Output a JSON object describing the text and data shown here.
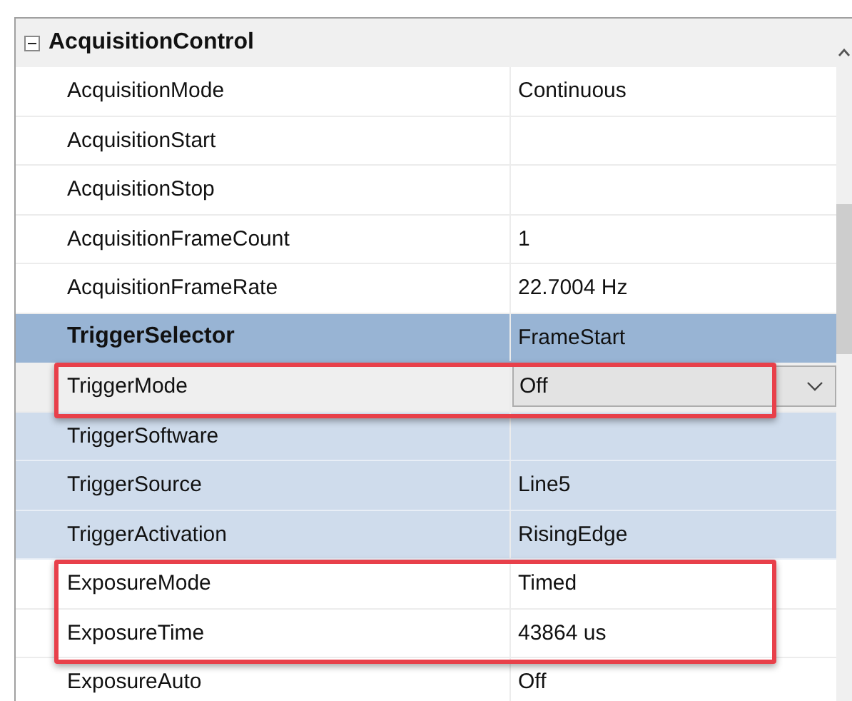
{
  "category": {
    "title": "AcquisitionControl",
    "expanded": true,
    "rows": [
      {
        "name": "AcquisitionMode",
        "value": "Continuous",
        "selected": false,
        "related": false,
        "editing": false,
        "annotated": false
      },
      {
        "name": "AcquisitionStart",
        "selected": false,
        "related": false,
        "editing": false,
        "annotated": false
      },
      {
        "name": "AcquisitionStop",
        "selected": false,
        "related": false,
        "editing": false,
        "annotated": false
      },
      {
        "name": "AcquisitionFrameCount",
        "value": "1",
        "selected": false,
        "related": false,
        "editing": false,
        "annotated": false
      },
      {
        "name": "AcquisitionFrameRate",
        "value": "22.7004 Hz",
        "selected": false,
        "related": false,
        "editing": false,
        "annotated": false
      },
      {
        "name": "TriggerSelector",
        "value": "FrameStart",
        "selected": true,
        "related": false,
        "editing": false,
        "annotated": false
      },
      {
        "name": "TriggerMode",
        "value": "Off",
        "selected": false,
        "related": false,
        "editing": true,
        "annotated": true
      },
      {
        "name": "TriggerSoftware",
        "selected": false,
        "related": true,
        "editing": false,
        "annotated": false
      },
      {
        "name": "TriggerSource",
        "value": "Line5",
        "selected": false,
        "related": true,
        "editing": false,
        "annotated": false
      },
      {
        "name": "TriggerActivation",
        "value": "RisingEdge",
        "selected": false,
        "related": true,
        "editing": false,
        "annotated": false
      },
      {
        "name": "ExposureMode",
        "value": "Timed",
        "selected": false,
        "related": false,
        "editing": false,
        "annotated": true
      },
      {
        "name": "ExposureTime",
        "value": "43864 us",
        "selected": false,
        "related": false,
        "editing": false,
        "annotated": true
      },
      {
        "name": "ExposureAuto",
        "value": "Off",
        "selected": false,
        "related": false,
        "editing": false,
        "annotated": false
      }
    ]
  }
}
